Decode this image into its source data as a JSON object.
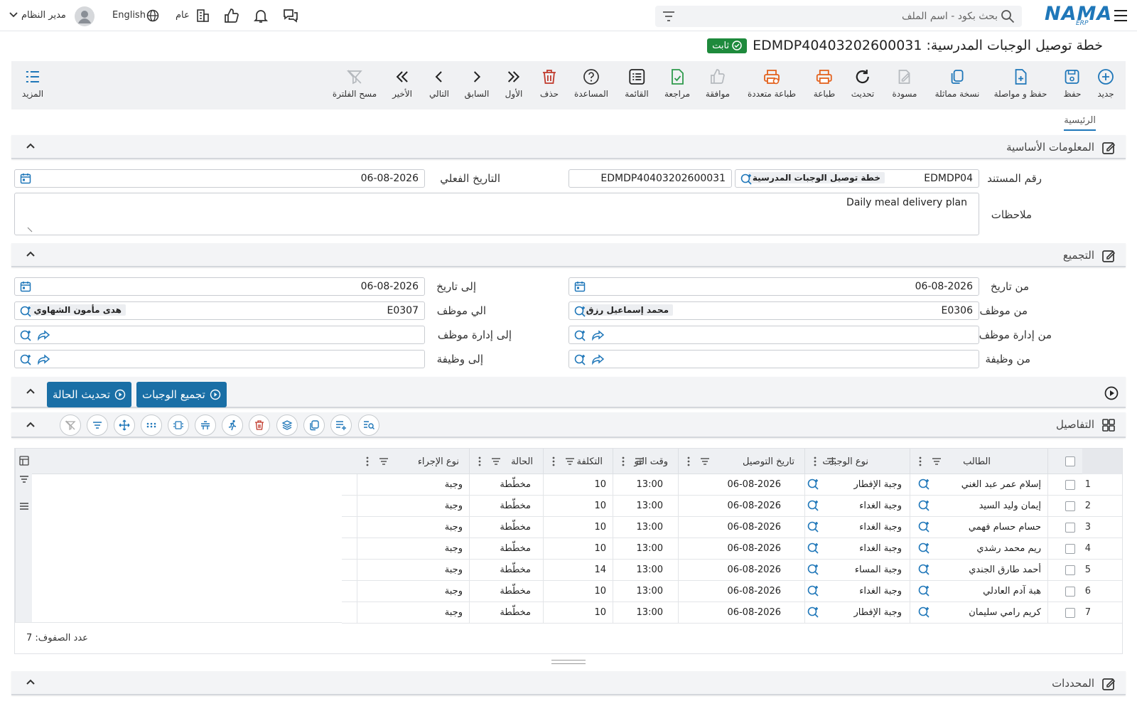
{
  "topbar": {
    "logo": "NAMA",
    "logo_sub": "ERP",
    "search_placeholder": "بحث بكود - اسم الملف",
    "user": "مدير النظام",
    "language": "English",
    "scope": "عام"
  },
  "document": {
    "title": "خطة توصيل الوجبات المدرسية: EDMDP40403202600031",
    "status": "ثابت"
  },
  "toolbar": {
    "new": "جديد",
    "save": "حفظ",
    "save_continue": "حفظ و مواصلة",
    "duplicate": "نسخة مماثلة",
    "draft": "مسودة",
    "refresh": "تحديث",
    "print": "طباعة",
    "multi_print": "طباعة متعددة",
    "approve": "موافقة",
    "review": "مراجعة",
    "list": "القائمة",
    "help": "المساعدة",
    "delete": "حذف",
    "first": "الأول",
    "previous": "السابق",
    "next": "التالي",
    "last": "الأخير",
    "clear_filter": "مسح الفلترة",
    "more": "المزيد"
  },
  "tabs": {
    "main": "الرئيسية"
  },
  "sections": {
    "basic_info": "المعلومات الأساسية",
    "grouping": "التجميع",
    "details": "التفاصيل",
    "selectors": "المحددات"
  },
  "basic": {
    "doc_number_label": "رقم المستند",
    "doc_code": "EDMDP04",
    "doc_type": "خطة توصيل الوجبات المدرسية",
    "doc_full_number": "EDMDP40403202600031",
    "actual_date_label": "التاريخ الفعلي",
    "actual_date": "06-08-2026",
    "notes_label": "ملاحظات",
    "notes": "Daily meal delivery plan"
  },
  "grouping": {
    "from_date_label": "من تاريخ",
    "from_date": "06-08-2026",
    "to_date_label": "إلى تاريخ",
    "to_date": "06-08-2026",
    "from_employee_label": "من موظف",
    "from_employee_code": "E0306",
    "from_employee_name": "محمد إسماعيل رزق",
    "to_employee_label": "الي موظف",
    "to_employee_code": "E0307",
    "to_employee_name": "هدى مأمون الشهاوي",
    "from_dept_label": "من إدارة موظف",
    "to_dept_label": "إلى إدارة موظف",
    "from_job_label": "من وظيفة",
    "to_job_label": "إلى وظيفة"
  },
  "actions": {
    "collect_meals": "تجميع الوجبات",
    "update_status": "تحديث الحالة"
  },
  "grid": {
    "columns": [
      "الطالب",
      "نوع الوجبات",
      "تاريخ التوصيل",
      "وقت التو",
      "التكلفة",
      "الحالة",
      "نوع الإجراء"
    ],
    "rows": [
      [
        "1",
        "إسلام عمر عبد الغني",
        "وجبة الإفطار",
        "06-08-2026",
        "13:00",
        "10",
        "مخطّطة",
        "وجبة"
      ],
      [
        "2",
        "إيمان وليد السيد",
        "وجبة الغداء",
        "06-08-2026",
        "13:00",
        "10",
        "مخطّطة",
        "وجبة"
      ],
      [
        "3",
        "حسام حسام فهمي",
        "وجبة الغداء",
        "06-08-2026",
        "13:00",
        "10",
        "مخطّطة",
        "وجبة"
      ],
      [
        "4",
        "ريم محمد رشدي",
        "وجبة الغداء",
        "06-08-2026",
        "13:00",
        "10",
        "مخطّطة",
        "وجبة"
      ],
      [
        "5",
        "أحمد طارق الجندي",
        "وجبة المساء",
        "06-08-2026",
        "13:00",
        "14",
        "مخطّطة",
        "وجبة"
      ],
      [
        "6",
        "هبة آدم العادلي",
        "وجبة الغداء",
        "06-08-2026",
        "13:00",
        "10",
        "مخطّطة",
        "وجبة"
      ],
      [
        "7",
        "كريم رامي سليمان",
        "وجبة الإفطار",
        "06-08-2026",
        "13:00",
        "10",
        "مخطّطة",
        "وجبة"
      ]
    ],
    "row_count": "عدد الصفوف: 7"
  },
  "colors": {
    "accent": "#1f77b9",
    "button": "#1a6fa6",
    "status_badge": "#1e8a3c",
    "print": "#e3611c",
    "review": "#2e9a4c",
    "delete": "#c0392b"
  }
}
